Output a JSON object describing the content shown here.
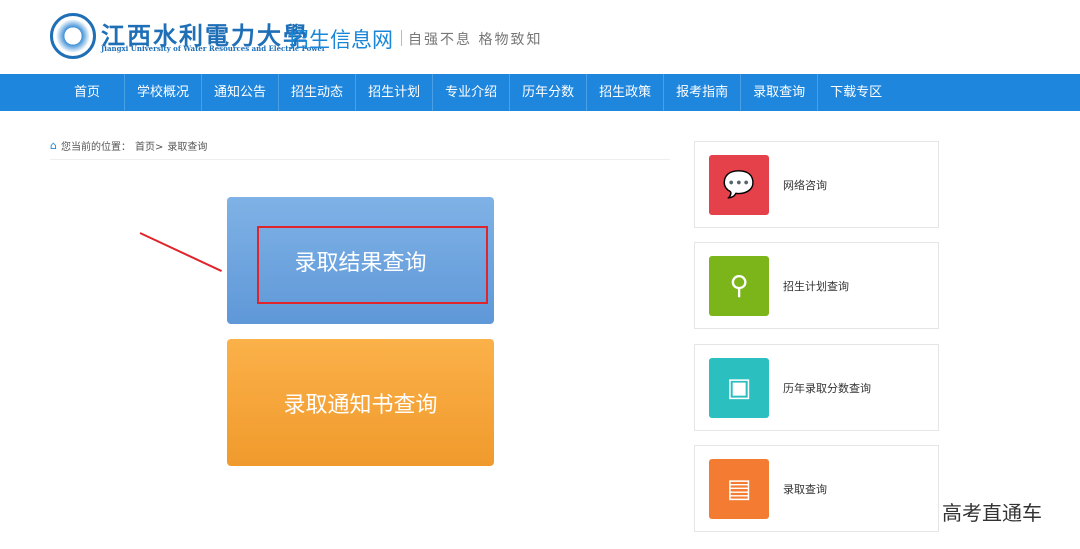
{
  "header": {
    "logo_cn": "江西水利電力大學",
    "logo_en": "Jiangxi University of Water Resources and Electric Power",
    "site_name": "招生信息网",
    "motto": "自强不息 格物致知"
  },
  "nav": [
    "首页",
    "学校概况",
    "通知公告",
    "招生动态",
    "招生计划",
    "专业介绍",
    "历年分数",
    "招生政策",
    "报考指南",
    "录取查询",
    "下载专区"
  ],
  "breadcrumb": {
    "label": "您当前的位置：",
    "home": "首页>",
    "current": "录取查询"
  },
  "cards": [
    {
      "label": "录取结果查询"
    },
    {
      "label": "录取通知书查询"
    }
  ],
  "side": [
    {
      "label": "网络咨询",
      "color": "#e5414a",
      "icon": "chat-icon"
    },
    {
      "label": "招生计划查询",
      "color": "#7cb519",
      "icon": "search-icon"
    },
    {
      "label": "历年录取分数查询",
      "color": "#2bbfc0",
      "icon": "score-icon"
    },
    {
      "label": "录取查询",
      "color": "#f47b32",
      "icon": "document-search-icon"
    }
  ],
  "watermark": "高考直通车"
}
